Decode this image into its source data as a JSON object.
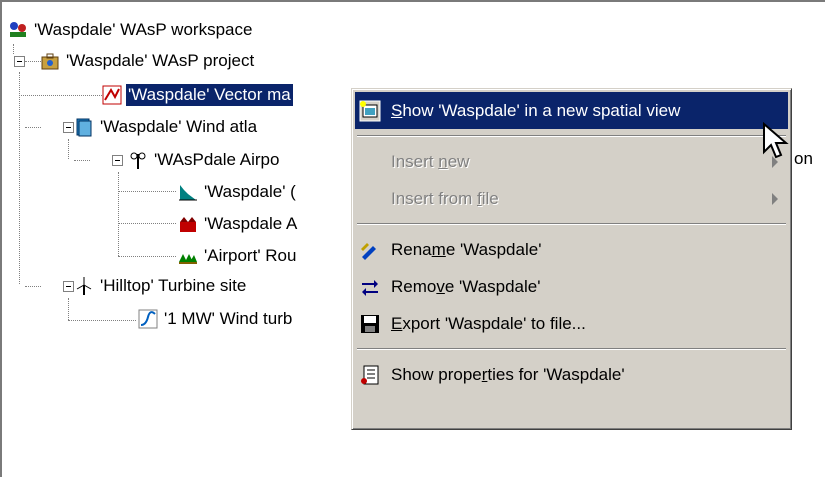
{
  "tree": {
    "workspace": "'Waspdale' WAsP workspace",
    "project": "'Waspdale' WAsP project",
    "vector_map": "'Waspdale' Vector ma",
    "wind_atlas": "'Waspdale' Wind atla",
    "airport": "'WAsPdale Airpo",
    "child1": "'Waspdale' (",
    "child2": "'Waspdale A",
    "child3": "'Airport' Rou",
    "turbine_site": "'Hilltop' Turbine site",
    "turbine": "'1 MW' Wind turb",
    "clipped_suffix": "on"
  },
  "menu": {
    "show_pre": "",
    "show_u": "S",
    "show_post": "how 'Waspdale' in a new spatial view",
    "insert_new_pre": "Insert ",
    "insert_new_u": "n",
    "insert_new_post": "ew",
    "insert_file_pre": "Insert from ",
    "insert_file_u": "f",
    "insert_file_post": "ile",
    "rename_pre": "Rena",
    "rename_u": "m",
    "rename_post": "e 'Waspdale'",
    "remove_pre": "Remo",
    "remove_u": "v",
    "remove_post": "e 'Waspdale'",
    "export_pre": "",
    "export_u": "E",
    "export_post": "xport 'Waspdale' to file...",
    "props_pre": "Show prope",
    "props_u": "r",
    "props_post": "ties for 'Waspdale'"
  },
  "colors": {
    "selection": "#0a246a",
    "menu_bg": "#d4d0c8",
    "disabled": "#808080"
  }
}
